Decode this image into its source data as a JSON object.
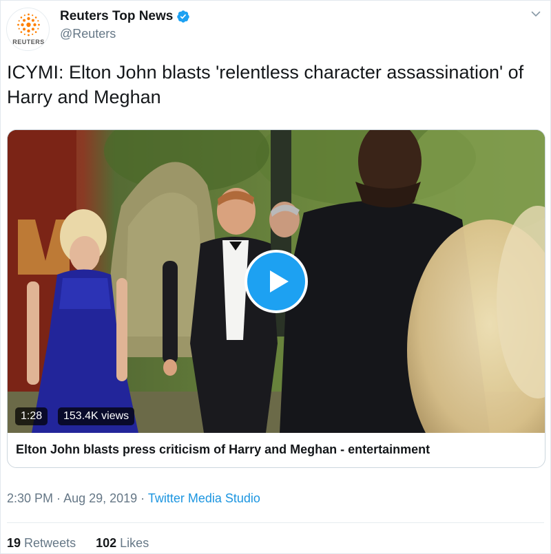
{
  "author": {
    "display_name": "Reuters Top News",
    "handle": "@Reuters",
    "avatar_label": "REUTERS",
    "brand_color": "#ff8000",
    "verified_color": "#1da1f2"
  },
  "icons": {
    "verified": "verified-badge-icon",
    "menu": "chevron-down-icon",
    "play": "play-icon"
  },
  "tweet": {
    "text": "ICYMI: Elton John blasts 'relentless character assassination' of Harry and Meghan"
  },
  "card": {
    "duration": "1:28",
    "views": "153.4K views",
    "title": "Elton John blasts press criticism of Harry and Meghan - entertainment"
  },
  "meta": {
    "time": "2:30 PM",
    "separator": " · ",
    "date": "Aug 29, 2019",
    "source": "Twitter Media Studio"
  },
  "stats": {
    "retweets_count": "19",
    "retweets_label": "Retweets",
    "likes_count": "102",
    "likes_label": "Likes"
  },
  "colors": {
    "link": "#1b95e0",
    "muted": "#657786",
    "text": "#14171a"
  }
}
